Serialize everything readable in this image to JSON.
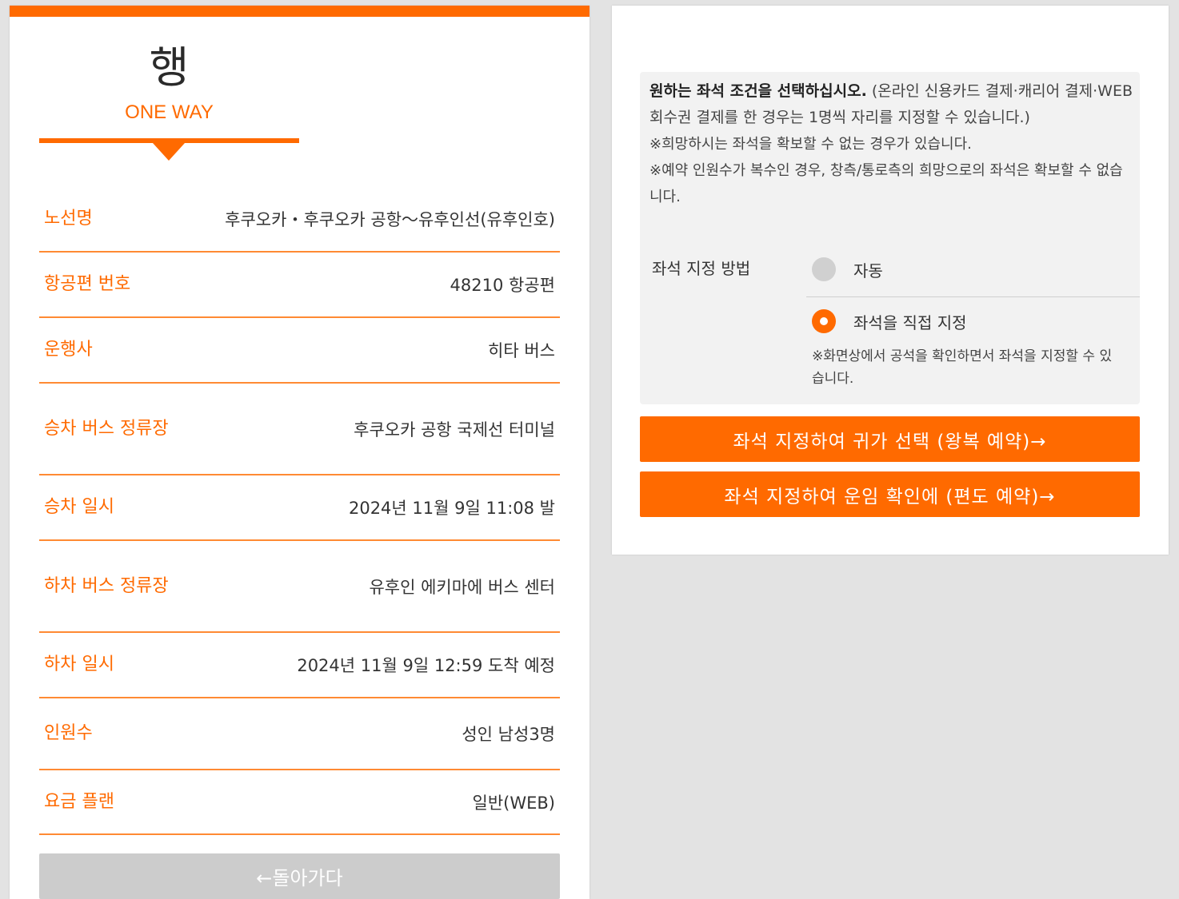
{
  "direction": {
    "kanji": "행",
    "english": "ONE WAY"
  },
  "details": [
    {
      "label": "노선명",
      "value": "후쿠오카・후쿠오카 공항～유후인선(유후인호)"
    },
    {
      "label": "항공편 번호",
      "value": "48210 항공편"
    },
    {
      "label": "운행사",
      "value": "히타 버스"
    },
    {
      "label": "승차 버스 정류장",
      "value": "후쿠오카 공항 국제선 터미널"
    },
    {
      "label": "승차 일시",
      "value": "2024년 11월 9일 11:08 발"
    },
    {
      "label": "하차 버스 정류장",
      "value": "유후인 에키마에 버스 센터"
    },
    {
      "label": "하차 일시",
      "value": "2024년 11월 9일 12:59 도착 예정"
    },
    {
      "label": "인원수",
      "value": "성인 남성3명"
    },
    {
      "label": "요금 플랜",
      "value": "일반(WEB)"
    }
  ],
  "back_button": "←돌아가다",
  "seat_info": {
    "heading": "원하는 좌석 조건을 선택하십시오.",
    "heading_rest": " (온라인 신용카드 결제·캐리어 결제·WEB 회수권 결제를 한 경우는 1명씩 자리를 지정할 수 있습니다.)",
    "note1": "※희망하시는 좌석을 확보할 수 없는 경우가 있습니다.",
    "note2": "※예약 인원수가 복수인 경우, 창측/통로측의 희망으로의 좌석은 확보할 수 없습니다.",
    "method_label": "좌석 지정 방법",
    "option_auto": "자동",
    "option_manual": "좌석을 직접 지정",
    "option_manual_note": "※화면상에서 공석을 확인하면서 좌석을 지정할 수 있습니다.",
    "selected": "manual"
  },
  "actions": {
    "round_trip": "좌석 지정하여 귀가 선택 (왕복 예약)→",
    "one_way": "좌석 지정하여 운임 확인에 (편도 예약)→"
  },
  "colors": {
    "accent": "#ff6a00",
    "disabled": "#cccccc",
    "background": "#e3e3e3"
  }
}
